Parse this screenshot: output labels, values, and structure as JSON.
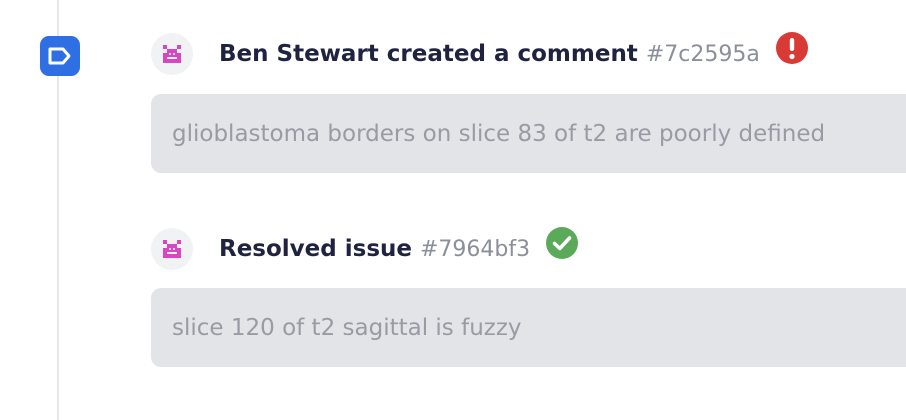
{
  "timeline": {
    "badge_icon": "comment-tag-icon",
    "badge_color": "#2f6fe4"
  },
  "entries": [
    {
      "avatar_icon": "pixel-invader-avatar-icon",
      "title": "Ben Stewart created a comment",
      "hash": "#7c2595a",
      "status_icon": "error-exclamation-icon",
      "status_color": "#d93a35",
      "comment": "glioblastoma borders on slice 83 of t2 are poorly defined"
    },
    {
      "avatar_icon": "pixel-invader-avatar-icon",
      "title": "Resolved issue",
      "hash": "#7964bf3",
      "status_icon": "success-check-icon",
      "status_color": "#5aaa5a",
      "comment": "slice 120 of t2 sagittal is fuzzy"
    }
  ]
}
